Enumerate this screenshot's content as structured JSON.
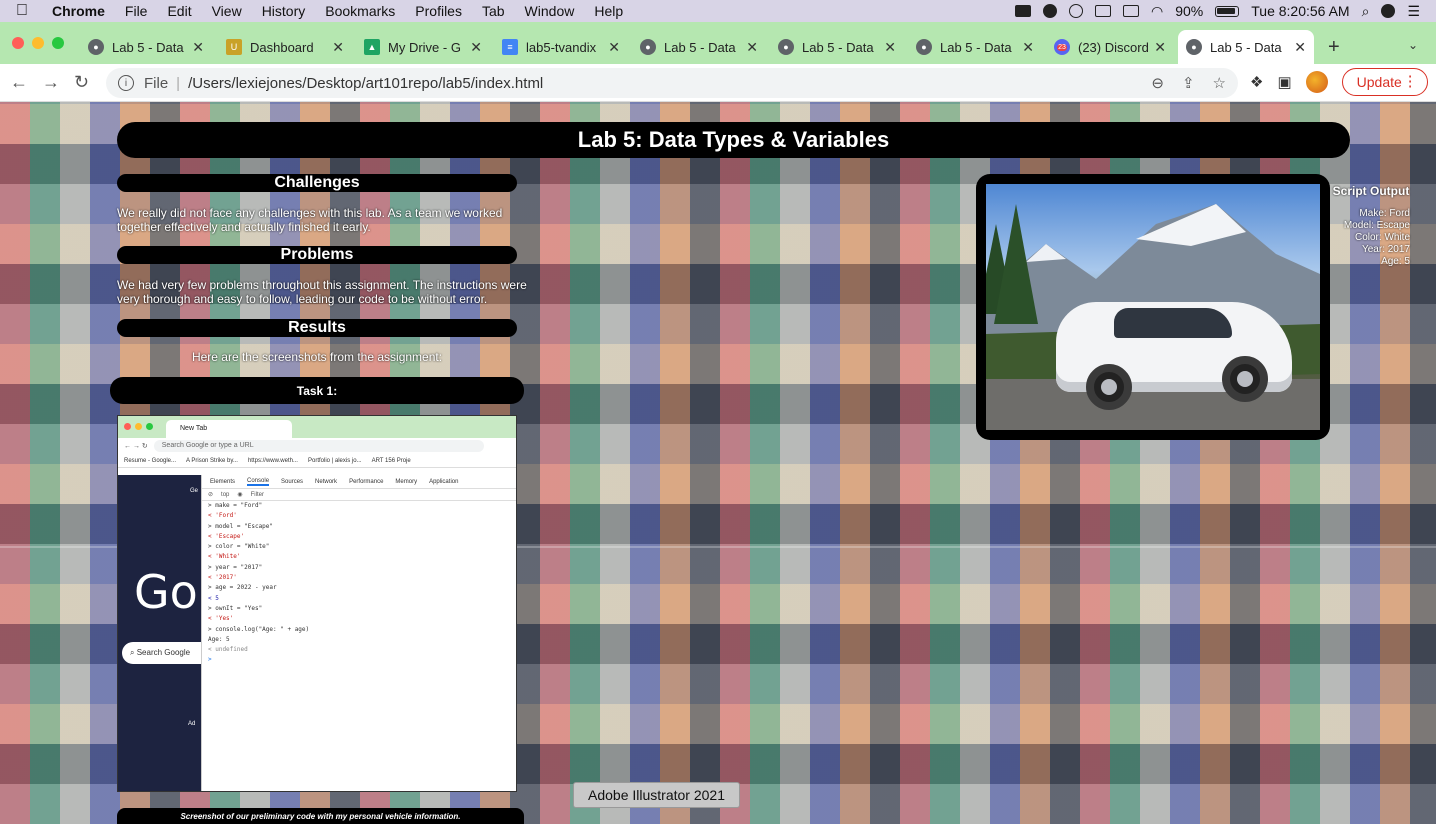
{
  "menubar": {
    "app": "Chrome",
    "items": [
      "File",
      "Edit",
      "View",
      "History",
      "Bookmarks",
      "Profiles",
      "Tab",
      "Window",
      "Help"
    ],
    "battery": "90%",
    "clock": "Tue 8:20:56 AM"
  },
  "tabs": [
    {
      "title": "Lab 5 - Data",
      "icon": "globe-icon",
      "color": "#5f6368"
    },
    {
      "title": "Dashboard",
      "icon": "ucsc-icon",
      "color": "#c9a227"
    },
    {
      "title": "My Drive - G",
      "icon": "drive-icon",
      "color": "#1fa463"
    },
    {
      "title": "lab5-tvandix",
      "icon": "docs-icon",
      "color": "#4285f4"
    },
    {
      "title": "Lab 5 - Data",
      "icon": "globe-icon",
      "color": "#5f6368"
    },
    {
      "title": "Lab 5 - Data",
      "icon": "globe-icon",
      "color": "#5f6368"
    },
    {
      "title": "Lab 5 - Data",
      "icon": "globe-icon",
      "color": "#5f6368"
    },
    {
      "title": "(23) Discord",
      "icon": "discord-icon",
      "color": "#5865f2",
      "badge": "23"
    },
    {
      "title": "Lab 5 - Data",
      "icon": "globe-icon",
      "color": "#5f6368"
    }
  ],
  "toolbar": {
    "scheme": "File",
    "url": "/Users/lexiejones/Desktop/art101repo/lab5/index.html",
    "update_label": "Update"
  },
  "page": {
    "title": "Lab 5: Data Types & Variables",
    "challenges_head": "Challenges",
    "challenges_text": "We really did not face any challenges with this lab. As a team we worked together effectively and actually finished it early.",
    "problems_head": "Problems",
    "problems_text": "We had very few problems throughout this assignment. The instructions were very thorough and easy to follow, leading our code to be without error.",
    "results_head": "Results",
    "results_text": "Here are the screenshots from the assignment:",
    "task_head": "Task 1:",
    "caption": "Screenshot of our preliminary code with my personal vehicle information.",
    "script_output": {
      "title": "Script Output",
      "lines": [
        "Make: Ford",
        "Model: Escape",
        "Color: White",
        "Year: 2017",
        "Age: 5"
      ]
    },
    "tooltip": "Adobe Illustrator 2021"
  },
  "screenshot": {
    "tab_title": "New Tab",
    "omnibox": "Search Google or type a URL",
    "bookmarks": [
      "Resume - Google...",
      "A Prison Strike by...",
      "https://www.weth...",
      "Portfolio | alexis jo...",
      "ART 156 Proje"
    ],
    "devtools_tabs": [
      "Elements",
      "Console",
      "Sources",
      "Network",
      "Performance",
      "Memory",
      "Application"
    ],
    "filter_context": "top",
    "filter_placeholder": "Filter",
    "google_logo": "Go",
    "google_search": "Search Google",
    "google_top": "Ge",
    "google_ad": "Ad",
    "console": [
      {
        "kind": "in",
        "text": "> make = \"Ford\""
      },
      {
        "kind": "out",
        "text": "< 'Ford'"
      },
      {
        "kind": "in",
        "text": "> model = \"Escape\""
      },
      {
        "kind": "out",
        "text": "< 'Escape'"
      },
      {
        "kind": "in",
        "text": "> color = \"White\""
      },
      {
        "kind": "out",
        "text": "< 'White'"
      },
      {
        "kind": "in",
        "text": "> year = \"2017\""
      },
      {
        "kind": "out",
        "text": "< '2017'"
      },
      {
        "kind": "in",
        "text": "> age = 2022 - year"
      },
      {
        "kind": "num",
        "text": "< 5"
      },
      {
        "kind": "in",
        "text": "> ownIt = \"Yes\""
      },
      {
        "kind": "out",
        "text": "< 'Yes'"
      },
      {
        "kind": "in",
        "text": "> console.log(\"Age: \" + age)"
      },
      {
        "kind": "log",
        "text": "  Age: 5"
      },
      {
        "kind": "und",
        "text": "< undefined"
      },
      {
        "kind": "in",
        "text": ">"
      }
    ]
  }
}
